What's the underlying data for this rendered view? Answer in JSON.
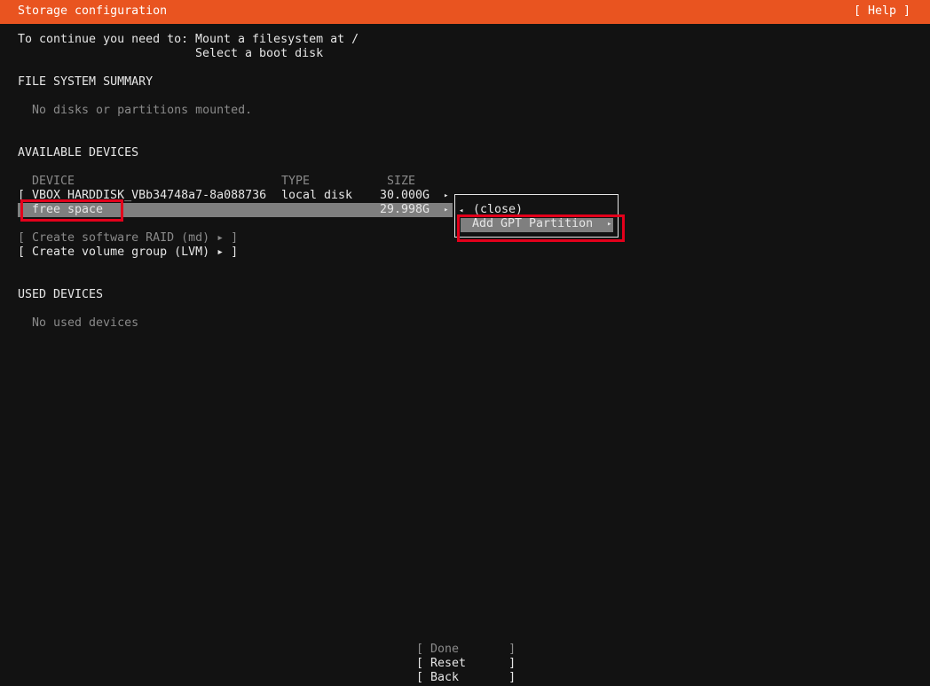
{
  "header": {
    "title": "Storage configuration",
    "help": "[ Help ]"
  },
  "intro": {
    "prefix": "To continue you need to:",
    "items": [
      "Mount a filesystem at /",
      "Select a boot disk"
    ]
  },
  "file_system_summary": {
    "heading": "FILE SYSTEM SUMMARY",
    "empty_text": "No disks or partitions mounted."
  },
  "available_devices": {
    "heading": "AVAILABLE DEVICES",
    "columns": {
      "device": "DEVICE",
      "type": "TYPE",
      "size": "SIZE"
    },
    "rows": [
      {
        "bracket": "[",
        "device": "VBOX_HARDDISK_VBb34748a7-8a088736",
        "type": "local disk",
        "size": "30.000G",
        "arrow": "▸"
      },
      {
        "bracket": "",
        "device": "free space",
        "type": "",
        "size": "29.998G",
        "arrow": "▸"
      }
    ],
    "actions": {
      "raid": "[ Create software RAID (md) ▸ ]",
      "lvm": "[ Create volume group (LVM) ▸ ]"
    }
  },
  "popup_menu": {
    "close_arrow": "◂",
    "close_label": "(close)",
    "add_label": "Add GPT Partition",
    "add_arrow": "▸"
  },
  "used_devices": {
    "heading": "USED DEVICES",
    "empty_text": "No used devices"
  },
  "footer": {
    "done": "[ Done       ]",
    "reset": "[ Reset      ]",
    "back": "[ Back       ]"
  },
  "colors": {
    "header_bg": "#e95420",
    "selection_bg": "#7f7f7f",
    "annotation_red": "#e3001b"
  }
}
